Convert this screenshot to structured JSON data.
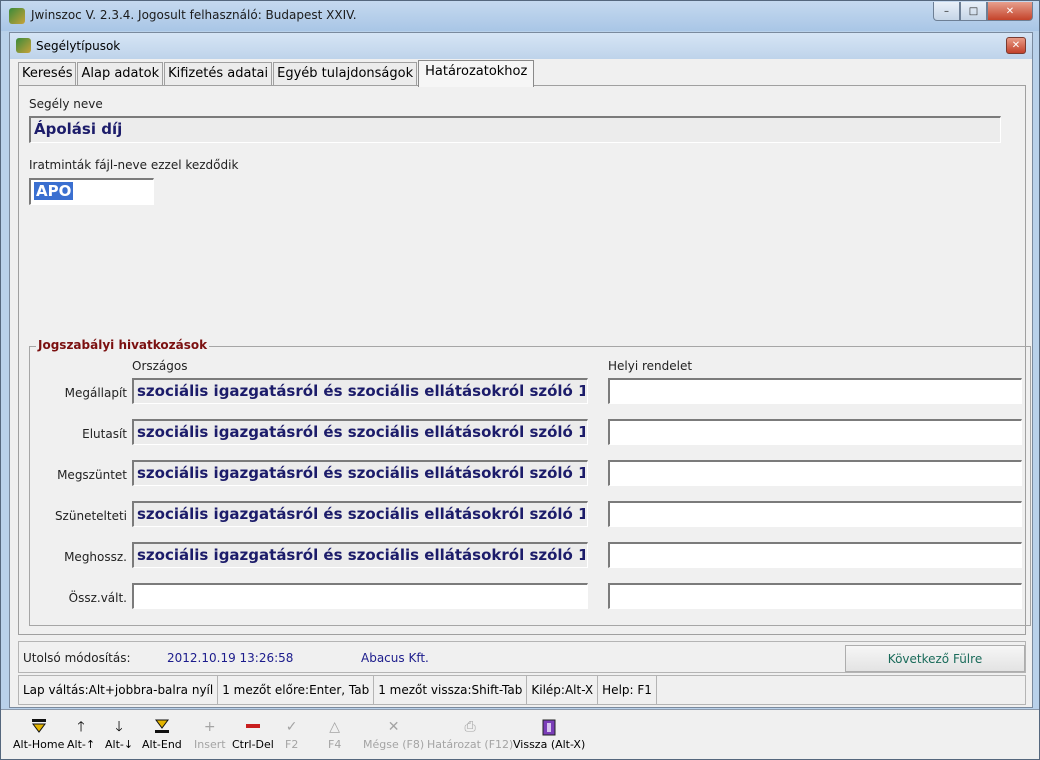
{
  "window": {
    "title": "Jwinszoc V. 2.3.4.  Jogosult felhasználó: Budapest XXIV.",
    "min": "–",
    "max": "□",
    "close": "✕"
  },
  "child": {
    "title": "Segélytípusok",
    "close": "✕"
  },
  "tabs": [
    {
      "label": "Keresés"
    },
    {
      "label": "Alap adatok"
    },
    {
      "label": "Kifizetés adatai"
    },
    {
      "label": "Egyéb tulajdonságok"
    },
    {
      "label": "Határozatokhoz"
    }
  ],
  "form": {
    "name_label": "Segély neve",
    "name_value": "Ápolási díj",
    "prefix_label": "Iratminták fájl-neve ezzel kezdődik",
    "prefix_value": "APO"
  },
  "group": {
    "title": "Jogszabályi hivatkozások",
    "col_national": "Országos",
    "col_local": "Helyi rendelet",
    "rows": [
      {
        "label": "Megállapít",
        "national": "szociális igazgatásról és szociális ellátásokról szóló 1",
        "local": ""
      },
      {
        "label": "Elutasít",
        "national": "szociális igazgatásról és szociális ellátásokról szóló 1",
        "local": ""
      },
      {
        "label": "Megszüntet",
        "national": "szociális igazgatásról és szociális ellátásokról szóló 1",
        "local": ""
      },
      {
        "label": "Szünetelteti",
        "national": "szociális igazgatásról és szociális ellátásokról szóló 1",
        "local": ""
      },
      {
        "label": "Meghossz.",
        "national": "szociális igazgatásról és szociális ellátásokról szóló 1",
        "local": ""
      },
      {
        "label": "Össz.vált.",
        "national": "",
        "local": ""
      }
    ]
  },
  "status": {
    "last_mod_label": "Utolsó módosítás:",
    "last_mod_value": "2012.10.19 13:26:58",
    "author": "Abacus Kft.",
    "next_tab": "Következő Fülre"
  },
  "hints": [
    "Lap váltás:Alt+jobbra-balra nyíl",
    "1 mezőt előre:Enter, Tab",
    "1 mezőt vissza:Shift-Tab",
    "Kilép:Alt-X",
    "Help: F1"
  ],
  "toolbar": [
    {
      "label": "Alt-Home",
      "icon": "first-icon"
    },
    {
      "label": "Alt-↑",
      "icon": "up-icon"
    },
    {
      "label": "Alt-↓",
      "icon": "down-icon"
    },
    {
      "label": "Alt-End",
      "icon": "last-icon"
    },
    {
      "label": "Insert",
      "icon": "plus-icon"
    },
    {
      "label": "Ctrl-Del",
      "icon": "minus-icon"
    },
    {
      "label": "F2",
      "icon": "check-icon"
    },
    {
      "label": "F4",
      "icon": "triangle-icon"
    },
    {
      "label": "Mégse (F8)",
      "icon": "x-icon"
    },
    {
      "label": "Határozat (F12)",
      "icon": "printer-icon"
    },
    {
      "label": "Vissza (Alt-X)",
      "icon": "exit-icon"
    }
  ]
}
